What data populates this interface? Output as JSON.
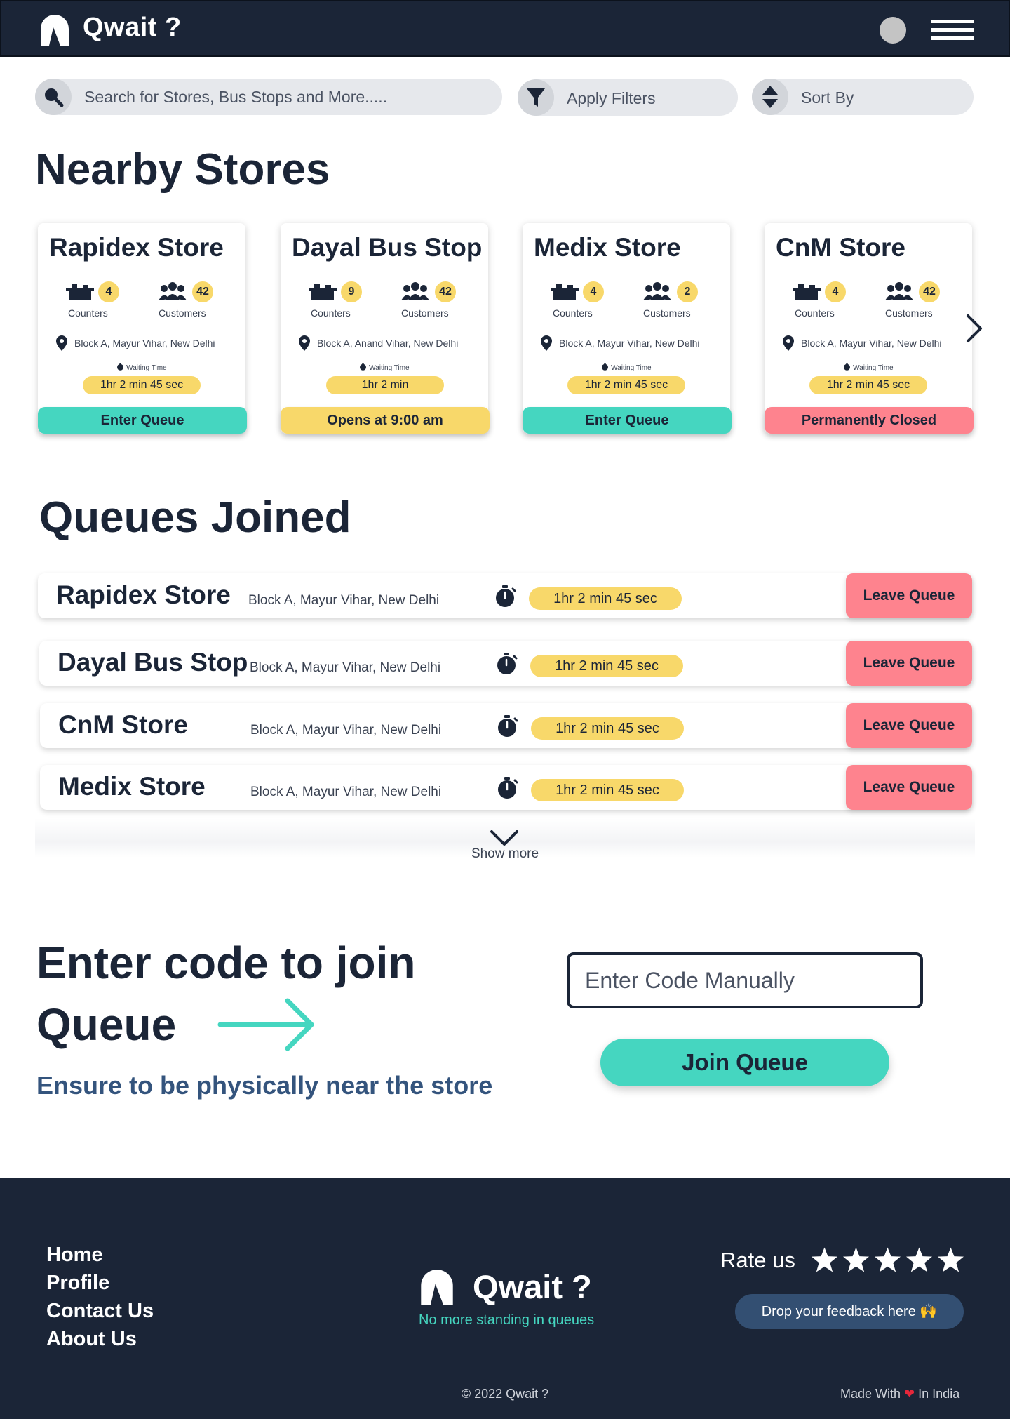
{
  "header": {
    "app_name": "Qwait ?"
  },
  "toolbar": {
    "search_placeholder": "Search for Stores, Bus Stops and More.....",
    "filters_label": "Apply Filters",
    "sort_label": "Sort By"
  },
  "nearby": {
    "title": "Nearby Stores",
    "counters_label": "Counters",
    "customers_label": "Customers",
    "waiting_label": "Waiting Time",
    "stores": [
      {
        "name": "Rapidex Store",
        "counters": "4",
        "customers": "42",
        "address": "Block A, Mayur Vihar, New Delhi",
        "wait": "1hr 2 min  45 sec",
        "action": "Enter Queue",
        "status": "open"
      },
      {
        "name": "Dayal Bus Stop",
        "counters": "9",
        "customers": "42",
        "address": "Block A, Anand Vihar, New Delhi",
        "wait": "1hr 2 min",
        "action": "Opens at 9:00 am",
        "status": "closed-now"
      },
      {
        "name": "Medix Store",
        "counters": "4",
        "customers": "2",
        "address": "Block A, Mayur Vihar, New Delhi",
        "wait": "1hr 2 min  45 sec",
        "action": "Enter Queue",
        "status": "open"
      },
      {
        "name": "CnM Store",
        "counters": "4",
        "customers": "42",
        "address": "Block A, Mayur Vihar, New Delhi",
        "wait": "1hr 2 min  45 sec",
        "action": "Permanently Closed",
        "status": "permanently-closed"
      }
    ]
  },
  "queues": {
    "title": "Queues Joined",
    "leave_label": "Leave Queue",
    "show_more": "Show more",
    "items": [
      {
        "name": "Rapidex Store",
        "address": "Block A, Mayur Vihar, New Delhi",
        "wait": "1hr 2 min  45 sec"
      },
      {
        "name": "Dayal Bus Stop",
        "address": "Block A, Mayur Vihar, New Delhi",
        "wait": "1hr 2 min  45 sec"
      },
      {
        "name": "CnM Store",
        "address": "Block A, Mayur Vihar, New Delhi",
        "wait": "1hr 2 min  45 sec"
      },
      {
        "name": "Medix Store",
        "address": "Block A, Mayur Vihar, New Delhi",
        "wait": "1hr 2 min  45 sec"
      }
    ]
  },
  "code": {
    "title": "Enter code to join Queue",
    "subtitle": "Ensure to be physically near the store",
    "placeholder": "Enter Code Manually",
    "join_label": "Join Queue"
  },
  "footer": {
    "links": [
      "Home",
      "Profile",
      "Contact  Us",
      "About Us"
    ],
    "app_name": "Qwait ?",
    "tagline": "No more standing in queues",
    "rate_label": "Rate us",
    "stars": 5,
    "feedback_label": "Drop your  feedback here 🙌",
    "copyright": "© 2022 Qwait ?",
    "made_with_prefix": "Made With",
    "made_with_suffix": "In India"
  },
  "colors": {
    "navy": "#1b2537",
    "teal": "#45d6c0",
    "yellow": "#f8d86a",
    "pink": "#fe838e",
    "subtitle_blue": "#34547d",
    "feedback_bg": "#334f72"
  },
  "icons": {
    "logo": "logo-arch-icon",
    "search": "search-icon",
    "filter": "filter-funnel-icon",
    "sort": "sort-updown-icon",
    "counter": "counter-desk-icon",
    "customers": "people-group-icon",
    "location": "location-pin-icon",
    "stopwatch": "stopwatch-icon",
    "next": "chevron-right-icon",
    "expand": "chevron-down-icon",
    "menu": "hamburger-menu-icon",
    "avatar": "user-avatar",
    "arrow": "arrow-right-icon",
    "star": "star-icon",
    "heart": "heart-icon"
  }
}
